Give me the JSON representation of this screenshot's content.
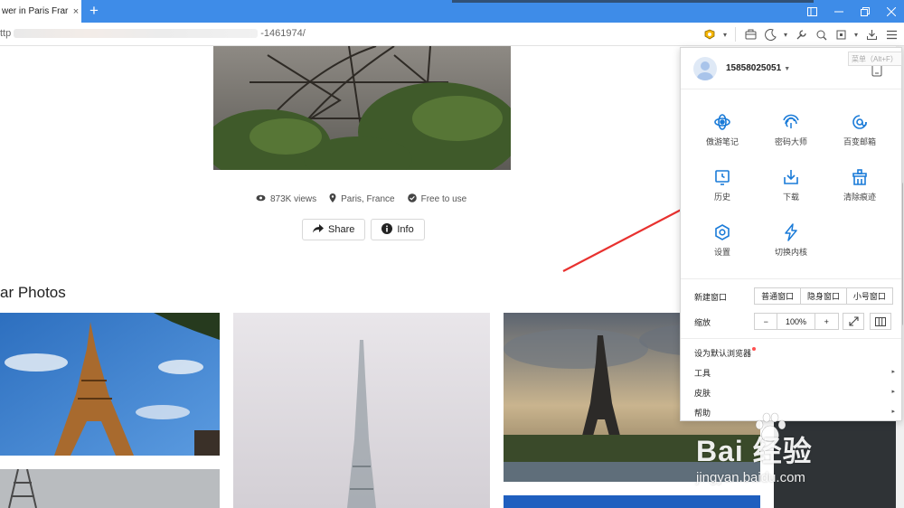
{
  "browser": {
    "tab_title": "wer in Paris Frar",
    "tab_close": "×",
    "new_tab": "+",
    "url_prefix": "ttp",
    "url_suffix": "-1461974/"
  },
  "page": {
    "meta": {
      "views": "873K views",
      "location": "Paris, France",
      "license": "Free to use"
    },
    "buttons": {
      "share": "Share",
      "info": "Info"
    },
    "section_title": "ar Photos"
  },
  "menu": {
    "hint": "菜单（Alt+F）",
    "username": "15858025051",
    "grid": [
      {
        "label": "傲游笔记",
        "icon": "note-icon"
      },
      {
        "label": "密码大师",
        "icon": "fingerprint-icon"
      },
      {
        "label": "百变邮箱",
        "icon": "mail-icon"
      },
      {
        "label": "历史",
        "icon": "history-icon"
      },
      {
        "label": "下载",
        "icon": "download-icon"
      },
      {
        "label": "清除痕迹",
        "icon": "clear-icon"
      },
      {
        "label": "设置",
        "icon": "settings-icon"
      },
      {
        "label": "切换内核",
        "icon": "lightning-icon"
      }
    ],
    "new_window": {
      "label": "新建窗口",
      "options": [
        "普通窗口",
        "隐身窗口",
        "小号窗口"
      ]
    },
    "zoom": {
      "label": "缩放",
      "minus": "−",
      "value": "100%",
      "plus": "+"
    },
    "items": [
      {
        "label": "设为默认浏览器",
        "arrow": ""
      },
      {
        "label": "工具",
        "arrow": "▸"
      },
      {
        "label": "皮肤",
        "arrow": "▸"
      },
      {
        "label": "帮助",
        "arrow": "▸"
      }
    ]
  },
  "watermark": {
    "main": "Bai 经验",
    "sub": "jingyan.baidu.com"
  },
  "colors": {
    "tab_strip": "#3e8ce8",
    "menu_icon_blue": "#1a7bd8",
    "arrow_red": "#e8312f"
  }
}
